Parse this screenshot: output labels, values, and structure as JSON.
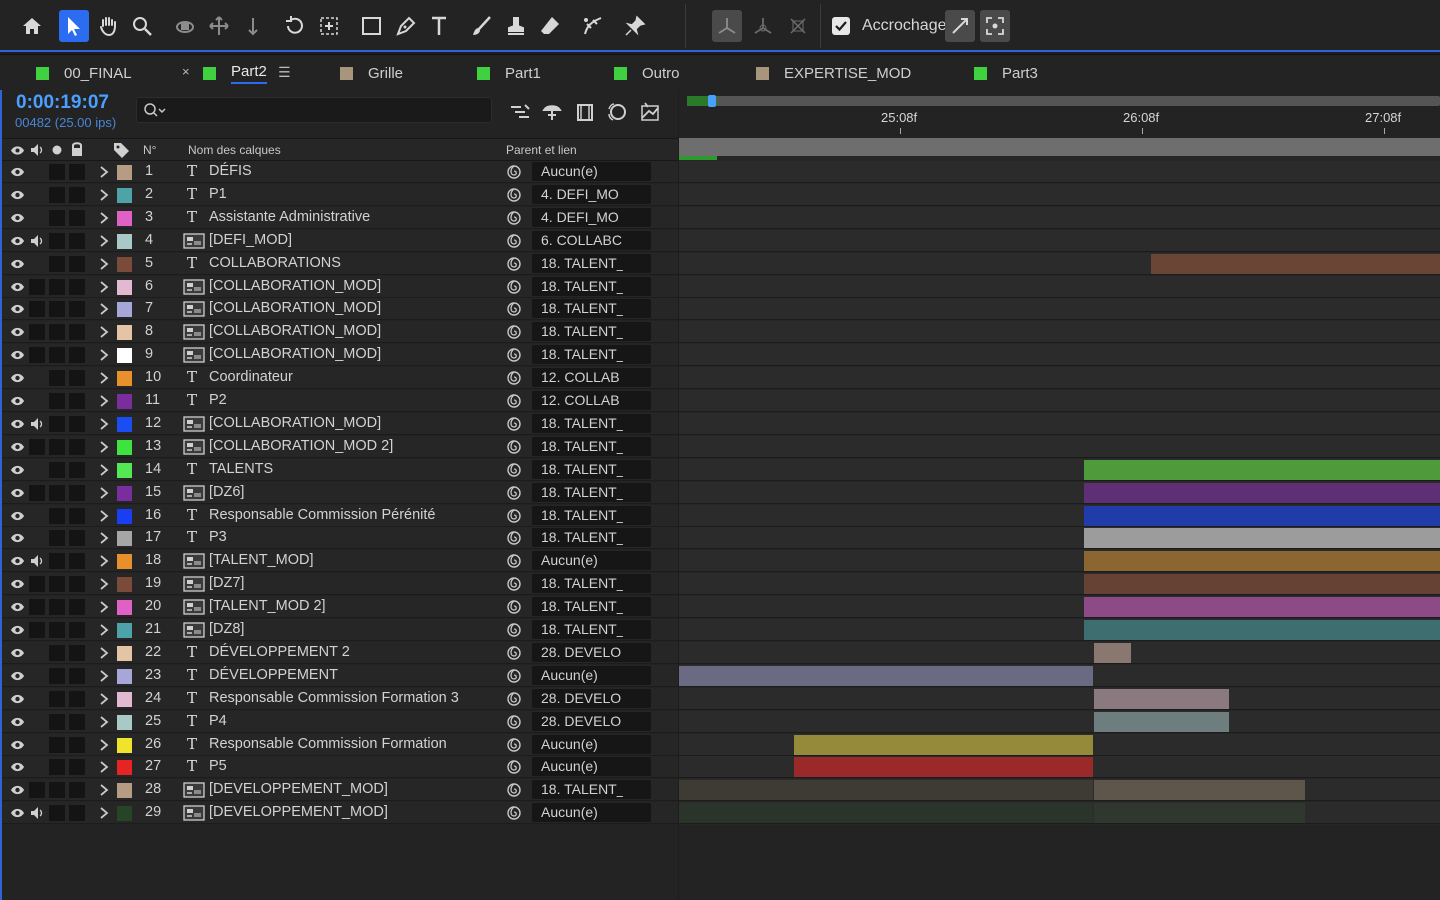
{
  "toolbar": {
    "snap_label": "Accrochage",
    "tools": [
      "home-icon",
      "selection-icon",
      "hand-icon",
      "zoom-icon",
      "orbit-icon",
      "pan-icon",
      "dolly-icon",
      "rotate-icon",
      "pan-behind-icon",
      "rectangle-icon",
      "pen-icon",
      "text-icon",
      "brush-icon",
      "clone-stamp-icon",
      "eraser-icon",
      "roto-brush-icon",
      "puppet-pin-icon"
    ]
  },
  "tabs": [
    {
      "label": "00_FINAL",
      "color": "#3fd13f"
    },
    {
      "label": "Part2",
      "color": "#3fd13f",
      "active": true
    },
    {
      "label": "Grille",
      "color": "#a7957c"
    },
    {
      "label": "Part1",
      "color": "#3fd13f"
    },
    {
      "label": "Outro",
      "color": "#3fd13f"
    },
    {
      "label": "EXPERTISE_MOD",
      "color": "#a7957c"
    },
    {
      "label": "Part3",
      "color": "#3fd13f"
    }
  ],
  "tab_close": "×",
  "tab_menu": "☰",
  "timecode": "0:00:19:07",
  "frame_info": "00482 (25.00 ips)",
  "columns": {
    "num": "N°",
    "name": "Nom des calques",
    "parent": "Parent et lien"
  },
  "ruler": [
    "25:08f",
    "26:08f",
    "27:08f"
  ],
  "layers": [
    {
      "num": "1",
      "type": "T",
      "name": "DÉFIS",
      "color": "#b69c83",
      "parent": "Aucun(e)",
      "audio": false,
      "solo": false
    },
    {
      "num": "2",
      "type": "T",
      "name": "P1",
      "color": "#4ea3a8",
      "parent": "4. DEFI_MO",
      "audio": false,
      "solo": false
    },
    {
      "num": "3",
      "type": "T",
      "name": "Assistante Administrative",
      "color": "#e061c6",
      "parent": "4. DEFI_MO",
      "audio": false,
      "solo": false
    },
    {
      "num": "4",
      "type": "C",
      "name": "[DEFI_MOD]",
      "color": "#a9c9c7",
      "parent": "6. COLLABC",
      "audio": true,
      "solo": false
    },
    {
      "num": "5",
      "type": "T",
      "name": "COLLABORATIONS",
      "color": "#7a4a3a",
      "parent": "18. TALENT_",
      "audio": false,
      "solo": false
    },
    {
      "num": "6",
      "type": "C",
      "name": "[COLLABORATION_MOD]",
      "color": "#e3b9d1",
      "parent": "18. TALENT_",
      "audio": false,
      "solo": true
    },
    {
      "num": "7",
      "type": "C",
      "name": "[COLLABORATION_MOD]",
      "color": "#a6a6d8",
      "parent": "18. TALENT_",
      "audio": false,
      "solo": true
    },
    {
      "num": "8",
      "type": "C",
      "name": "[COLLABORATION_MOD]",
      "color": "#e3c4a4",
      "parent": "18. TALENT_",
      "audio": false,
      "solo": true
    },
    {
      "num": "9",
      "type": "C",
      "name": "[COLLABORATION_MOD]",
      "color": "#ffffff",
      "parent": "18. TALENT_",
      "audio": false,
      "solo": true
    },
    {
      "num": "10",
      "type": "T",
      "name": "Coordinateur",
      "color": "#e8902b",
      "parent": "12. COLLAB",
      "audio": false,
      "solo": false
    },
    {
      "num": "11",
      "type": "T",
      "name": "P2",
      "color": "#7a2d9c",
      "parent": "12. COLLAB",
      "audio": false,
      "solo": false
    },
    {
      "num": "12",
      "type": "C",
      "name": "[COLLABORATION_MOD]",
      "color": "#1a4df2",
      "parent": "18. TALENT_",
      "audio": true,
      "solo": false
    },
    {
      "num": "13",
      "type": "C",
      "name": "[COLLABORATION_MOD 2]",
      "color": "#3fe33f",
      "parent": "18. TALENT_",
      "audio": false,
      "solo": true
    },
    {
      "num": "14",
      "type": "T",
      "name": "TALENTS",
      "color": "#54e854",
      "parent": "18. TALENT_",
      "audio": false,
      "solo": false
    },
    {
      "num": "15",
      "type": "C",
      "name": "[DZ6]",
      "color": "#7a2d9c",
      "parent": "18. TALENT_",
      "audio": false,
      "solo": true
    },
    {
      "num": "16",
      "type": "T",
      "name": "Responsable Commission Pérénité",
      "color": "#1a3ef2",
      "parent": "18. TALENT_",
      "audio": false,
      "solo": false
    },
    {
      "num": "17",
      "type": "T",
      "name": "P3",
      "color": "#a6a6a6",
      "parent": "18. TALENT_",
      "audio": false,
      "solo": false
    },
    {
      "num": "18",
      "type": "C",
      "name": "[TALENT_MOD]",
      "color": "#e8902b",
      "parent": "Aucun(e)",
      "audio": true,
      "solo": false
    },
    {
      "num": "19",
      "type": "C",
      "name": "[DZ7]",
      "color": "#7a4a3a",
      "parent": "18. TALENT_",
      "audio": false,
      "solo": true
    },
    {
      "num": "20",
      "type": "C",
      "name": "[TALENT_MOD 2]",
      "color": "#e061c6",
      "parent": "18. TALENT_",
      "audio": false,
      "solo": true
    },
    {
      "num": "21",
      "type": "C",
      "name": "[DZ8]",
      "color": "#4ea3a8",
      "parent": "18. TALENT_",
      "audio": false,
      "solo": true
    },
    {
      "num": "22",
      "type": "T",
      "name": "DÉVELOPPEMENT 2",
      "color": "#e3c4a4",
      "parent": "28. DEVELO",
      "audio": false,
      "solo": false
    },
    {
      "num": "23",
      "type": "T",
      "name": "DÉVELOPPEMENT",
      "color": "#a6a6d8",
      "parent": "Aucun(e)",
      "audio": false,
      "solo": false
    },
    {
      "num": "24",
      "type": "T",
      "name": "Responsable Commission Formation 3",
      "color": "#e3b9d1",
      "parent": "28. DEVELO",
      "audio": false,
      "solo": false
    },
    {
      "num": "25",
      "type": "T",
      "name": "P4",
      "color": "#a9c9c7",
      "parent": "28. DEVELO",
      "audio": false,
      "solo": false
    },
    {
      "num": "26",
      "type": "T",
      "name": "Responsable Commission Formation",
      "color": "#f0e32c",
      "parent": "Aucun(e)",
      "audio": false,
      "solo": false
    },
    {
      "num": "27",
      "type": "T",
      "name": "P5",
      "color": "#e62424",
      "parent": "Aucun(e)",
      "audio": false,
      "solo": false
    },
    {
      "num": "28",
      "type": "C",
      "name": "[DEVELOPPEMENT_MOD]",
      "color": "#b69c83",
      "parent": "18. TALENT_",
      "audio": false,
      "solo": true
    },
    {
      "num": "29",
      "type": "C",
      "name": "[DEVELOPPEMENT_MOD]",
      "color": "#264426",
      "parent": "Aucun(e)",
      "audio": true,
      "solo": false
    }
  ],
  "timeline_bars": [
    {
      "row": 5,
      "start": 472,
      "end": 761,
      "color": "#6a4536"
    },
    {
      "row": 14,
      "start": 405,
      "end": 761,
      "color": "#4f9a3a"
    },
    {
      "row": 15,
      "start": 405,
      "end": 761,
      "color": "#5e2f74"
    },
    {
      "row": 16,
      "start": 405,
      "end": 761,
      "color": "#1f3ca8"
    },
    {
      "row": 17,
      "start": 405,
      "end": 761,
      "color": "#9c9c9c"
    },
    {
      "row": 18,
      "start": 405,
      "end": 761,
      "color": "#8c6630"
    },
    {
      "row": 19,
      "start": 405,
      "end": 761,
      "color": "#664234"
    },
    {
      "row": 20,
      "start": 405,
      "end": 761,
      "color": "#8c4a86"
    },
    {
      "row": 21,
      "start": 405,
      "end": 761,
      "color": "#3e6e70"
    },
    {
      "row": 22,
      "start": 415,
      "end": 452,
      "color": "#8a7870"
    },
    {
      "row": 23,
      "start": 0,
      "end": 414,
      "color": "#6a6a82"
    },
    {
      "row": 24,
      "start": 415,
      "end": 550,
      "color": "#8a7a80"
    },
    {
      "row": 25,
      "start": 415,
      "end": 550,
      "color": "#6e7e7e"
    },
    {
      "row": 26,
      "start": 115,
      "end": 414,
      "color": "#948a3a"
    },
    {
      "row": 27,
      "start": 115,
      "end": 414,
      "color": "#9a2a2a"
    },
    {
      "row": 28,
      "start": 0,
      "end": 414,
      "color": "#3e3a34"
    },
    {
      "row": 28,
      "start": 415,
      "end": 626,
      "color": "#5e564a"
    },
    {
      "row": 29,
      "start": 0,
      "end": 414,
      "color": "#2a342a"
    },
    {
      "row": 29,
      "start": 415,
      "end": 626,
      "color": "#2f372f"
    }
  ]
}
